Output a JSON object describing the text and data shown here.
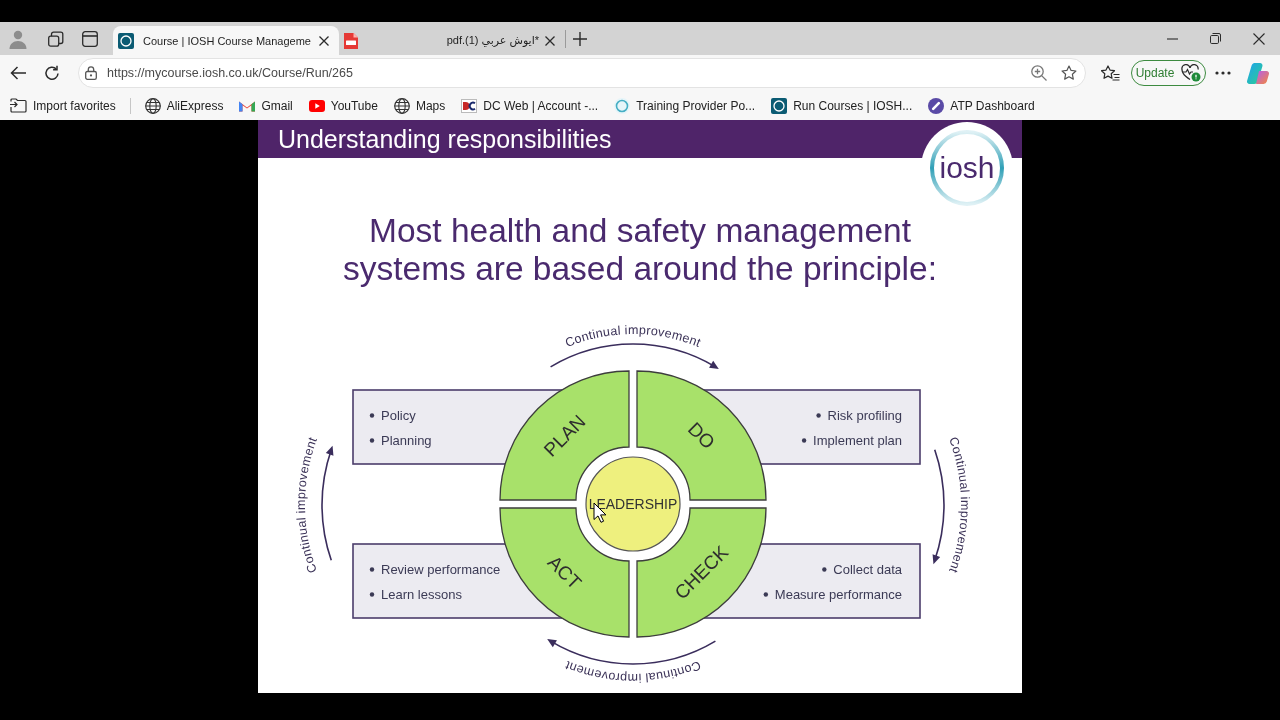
{
  "browser": {
    "tabs": [
      {
        "title": "Course | IOSH Course Manageme",
        "kind": "web",
        "selected": true
      },
      {
        "title": "*ايوش عربي (1).pdf",
        "kind": "pdf",
        "selected": false
      }
    ],
    "address_bar": {
      "url": "https://mycourse.iosh.co.uk/Course/Run/265"
    },
    "update_button": {
      "label": "Update"
    },
    "favorites": [
      {
        "label": "Import favorites",
        "kind": "import"
      },
      {
        "label": "AliExpress",
        "kind": "globe"
      },
      {
        "label": "Gmail",
        "kind": "mail"
      },
      {
        "label": "YouTube",
        "kind": "video"
      },
      {
        "label": "Maps",
        "kind": "globe"
      },
      {
        "label": "DC Web | Account -...",
        "kind": "dc"
      },
      {
        "label": "Training Provider Po...",
        "kind": "ring"
      },
      {
        "label": "Run Courses | IOSH...",
        "kind": "tile"
      },
      {
        "label": "ATP Dashboard",
        "kind": "disc"
      }
    ]
  },
  "slide": {
    "title": "Understanding responsibilities",
    "logo": "iosh",
    "heading": "Most health and safety management systems are based around the principle:",
    "diagram": {
      "centre": "LEADERSHIP",
      "stages": [
        {
          "label": "PLAN",
          "items": [
            "Policy",
            "Planning"
          ]
        },
        {
          "label": "DO",
          "items": [
            "Risk profiling",
            "Implement plan"
          ]
        },
        {
          "label": "CHECK",
          "items": [
            "Collect data",
            "Measure performance"
          ]
        },
        {
          "label": "ACT",
          "items": [
            "Review performance",
            "Learn lessons"
          ]
        }
      ],
      "cycle": [
        "Continual improvement",
        "Continual improvement",
        "Continual improvement",
        "Continual improvement"
      ]
    }
  }
}
